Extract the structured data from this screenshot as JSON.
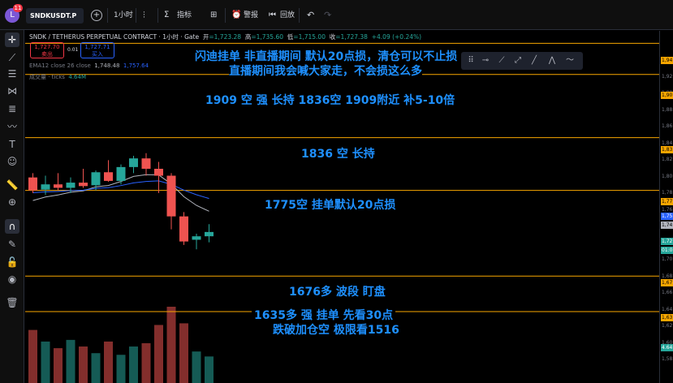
{
  "toolbar": {
    "avatar_letter": "L",
    "avatar_badge": "11",
    "symbol": "SNDKUSDT.P",
    "add_label": "+",
    "interval": "1小时",
    "indicators_label": "指标",
    "alert_label": "警报",
    "replay_label": "回放"
  },
  "legend": {
    "title": "SNDK / TETHERUS PERPETUAL CONTRACT · 1小时 · Gate",
    "open_label": "开",
    "open": "=1,723.28",
    "high_label": "高",
    "high": "=1,735.60",
    "low_label": "低",
    "low": "=1,715.00",
    "close_label": "收",
    "close": "=1,727.38",
    "change": "+4.09 (+0.24%)",
    "sell_price": "1,727.70",
    "sell_label": "卖出",
    "spread": "0.01",
    "buy_price": "1,727.71",
    "buy_label": "买入",
    "ema_label": "EMA12 close 26 close",
    "ema_v1": "1,748.48",
    "ema_v2": "1,757.64",
    "volume_label": "成交量 · ticks",
    "volume_value": "4.64M"
  },
  "annotations": {
    "line1": "闪迪挂单 非直播期间 默认20点损，清仓可以不止损",
    "line2": "直播期间我会喊大家走，不会损这么多",
    "l1909": "1909 空  强  长持     1836空  1909附近  补5-10倍",
    "l1836": "1836  空  长持",
    "l1775": "1775空       挂单默认20点损",
    "l1676": "1676多  波段  盯盘",
    "l1635a": "1635多  强  挂单     先看30点",
    "l1635b": "跌破加仓空  极限看1516"
  },
  "axis": {
    "labels": [
      "1,94",
      "1,92",
      "1,90",
      "1,88",
      "1,86",
      "1,84",
      "1,82",
      "1,80",
      "1,78",
      "1,76",
      "1,74",
      "1,72",
      "1,70",
      "1,68",
      "1,66",
      "1,64",
      "1,62",
      "1,60",
      "1,58"
    ],
    "tags": [
      "1,94",
      "1,90",
      "1,83",
      "1,77",
      "1,75",
      "1,74",
      "1,72",
      "01:06",
      "1,67",
      "1,63",
      "4.64"
    ]
  },
  "colors": {
    "level_line": "#f7a600",
    "up": "#26a69a",
    "down": "#ef5350",
    "annotation": "#1e90ff"
  },
  "chart_data": {
    "type": "candlestick",
    "price_levels": [
      1945,
      1909,
      1836,
      1775,
      1676,
      1635
    ],
    "candles": [
      {
        "o": 1790,
        "h": 1795,
        "l": 1772,
        "c": 1775
      },
      {
        "o": 1776,
        "h": 1792,
        "l": 1770,
        "c": 1782
      },
      {
        "o": 1782,
        "h": 1795,
        "l": 1775,
        "c": 1778
      },
      {
        "o": 1778,
        "h": 1790,
        "l": 1772,
        "c": 1784
      },
      {
        "o": 1784,
        "h": 1800,
        "l": 1778,
        "c": 1780
      },
      {
        "o": 1781,
        "h": 1798,
        "l": 1775,
        "c": 1796
      },
      {
        "o": 1796,
        "h": 1810,
        "l": 1785,
        "c": 1786
      },
      {
        "o": 1786,
        "h": 1805,
        "l": 1782,
        "c": 1802
      },
      {
        "o": 1802,
        "h": 1815,
        "l": 1795,
        "c": 1812
      },
      {
        "o": 1812,
        "h": 1818,
        "l": 1792,
        "c": 1800
      },
      {
        "o": 1800,
        "h": 1808,
        "l": 1772,
        "c": 1792
      },
      {
        "o": 1792,
        "h": 1795,
        "l": 1730,
        "c": 1745
      },
      {
        "o": 1745,
        "h": 1750,
        "l": 1712,
        "c": 1716
      },
      {
        "o": 1718,
        "h": 1725,
        "l": 1707,
        "c": 1722
      },
      {
        "o": 1722,
        "h": 1736,
        "l": 1715,
        "c": 1727
      }
    ],
    "volumes": [
      3.2,
      2.5,
      2.1,
      2.6,
      2.2,
      1.8,
      2.5,
      1.7,
      2.2,
      2.4,
      3.5,
      4.6,
      3.6,
      1.9,
      1.6
    ],
    "ylim": [
      1575,
      1950
    ]
  }
}
